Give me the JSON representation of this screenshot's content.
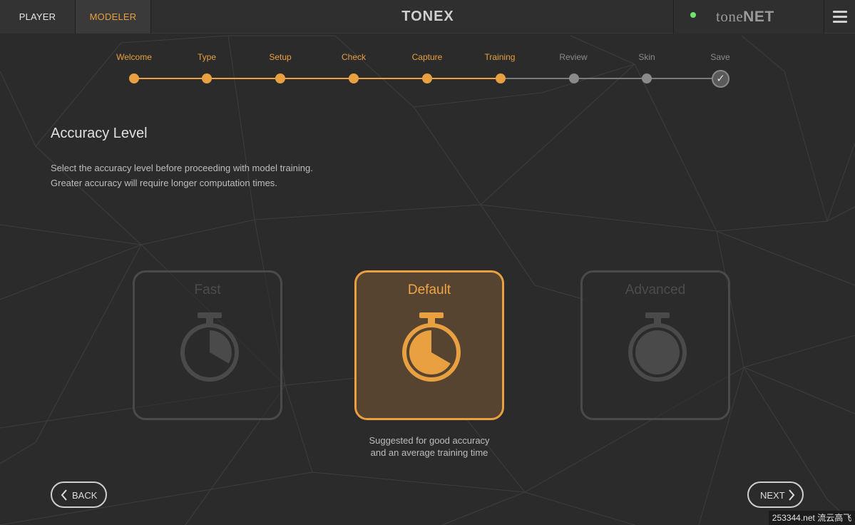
{
  "tabs": {
    "player": "PLAYER",
    "modeler": "MODELER"
  },
  "brand": {
    "title": "TONEX"
  },
  "tonenet": {
    "tone": "tone",
    "net": "NET"
  },
  "status_color": "#6ee46e",
  "accent_color": "#e8a040",
  "steps": [
    {
      "label": "Welcome",
      "state": "done"
    },
    {
      "label": "Type",
      "state": "done"
    },
    {
      "label": "Setup",
      "state": "done"
    },
    {
      "label": "Check",
      "state": "done"
    },
    {
      "label": "Capture",
      "state": "done"
    },
    {
      "label": "Training",
      "state": "current"
    },
    {
      "label": "Review",
      "state": "pending"
    },
    {
      "label": "Skin",
      "state": "pending"
    },
    {
      "label": "Save",
      "state": "pending"
    }
  ],
  "heading": {
    "title": "Accuracy Level",
    "desc_line1": "Select the accuracy level before proceeding with model training.",
    "desc_line2": "Greater accuracy will require longer computation times."
  },
  "options": [
    {
      "label": "Fast",
      "icon": "stopwatch-icon",
      "selected": false
    },
    {
      "label": "Default",
      "icon": "stopwatch-icon",
      "selected": true
    },
    {
      "label": "Advanced",
      "icon": "stopwatch-icon",
      "selected": false
    }
  ],
  "suggestion": {
    "line1": "Suggested for good accuracy",
    "line2": "and an average training time"
  },
  "nav": {
    "back": "BACK",
    "next": "NEXT"
  },
  "watermark": "253344.net 流云高飞"
}
